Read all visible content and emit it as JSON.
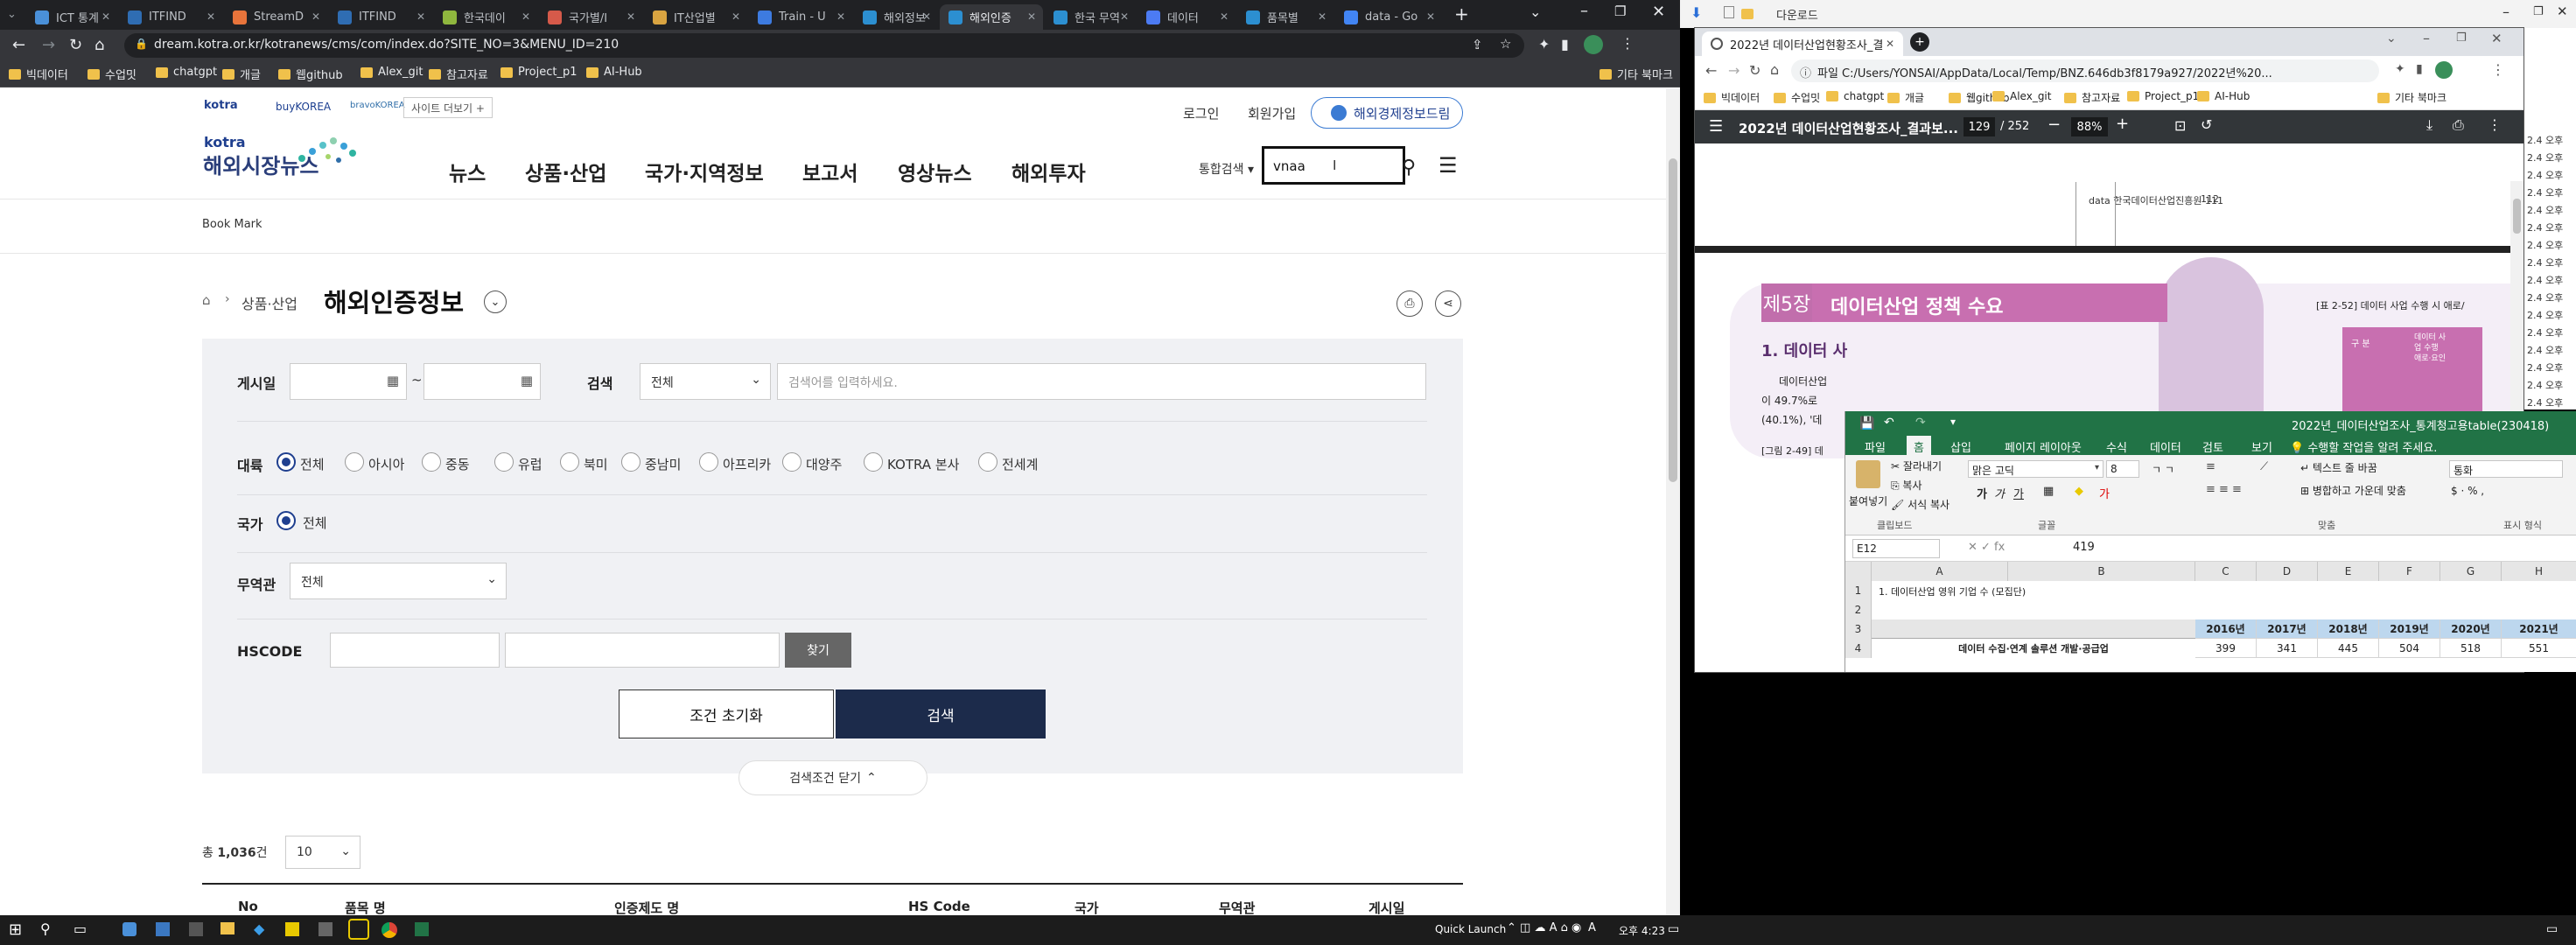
{
  "browser": {
    "tabs": [
      {
        "label": "ICT 통계",
        "color": "#4a90d9"
      },
      {
        "label": "ITFIND",
        "color": "#2f6db3"
      },
      {
        "label": "StreamD",
        "color": "#e8743b"
      },
      {
        "label": "ITFIND",
        "color": "#2f6db3"
      },
      {
        "label": "한국데이",
        "color": "#8fb73e"
      },
      {
        "label": "국가별/I",
        "color": "#d65a4a"
      },
      {
        "label": "IT산업별",
        "color": "#d9a441"
      },
      {
        "label": "Train - U",
        "color": "#3d7be0"
      },
      {
        "label": "해외정보",
        "color": "#2c8fd1"
      },
      {
        "label": "해외인증",
        "color": "#2c8fd1"
      },
      {
        "label": "한국 무역",
        "color": "#2c8fd1"
      },
      {
        "label": "데이터",
        "color": "#4c7bf3"
      },
      {
        "label": "품목별",
        "color": "#2c8fd1"
      },
      {
        "label": "data - Go",
        "color": "#4285f4"
      }
    ],
    "url": "dream.kotra.or.kr/kotranews/cms/com/index.do?SITE_NO=3&MENU_ID=210",
    "bookmarks": [
      "빅데이터",
      "수업밋",
      "chatgpt",
      "개글",
      "웹github",
      "Alex_git",
      "참고자료",
      "Project_p1",
      "AI-Hub"
    ],
    "bookmarks_right": "기타 북마크"
  },
  "kotra": {
    "logos": [
      "kotra",
      "buyKOREA",
      "bravoKOREA"
    ],
    "site_more": "사이트 더보기 +",
    "logo_kotra": "kotra",
    "logo_main": "해외시장뉴스",
    "top_links": [
      "로그인",
      "회원가입"
    ],
    "econ_board": "해외경제정보드림",
    "nav": [
      "뉴스",
      "상품·산업",
      "국가·지역정보",
      "보고서",
      "영상뉴스",
      "해외투자"
    ],
    "search_scope": "통합검색",
    "search_value": "vnaa",
    "bookmark": "Book Mark",
    "breadcrumb": "상품·산업",
    "page_title": "해외인증정보",
    "form": {
      "post_date": "게시일",
      "tilde": "~",
      "search": "검색",
      "search_select": "전체",
      "search_placeholder": "검색어를 입력하세요.",
      "continent": "대륙",
      "continents": [
        "전체",
        "아시아",
        "중동",
        "유럽",
        "북미",
        "중남미",
        "아프리카",
        "대양주",
        "KOTRA 본사",
        "전세계"
      ],
      "country": "국가",
      "country_opt": "전체",
      "trade_office": "무역관",
      "trade_select": "전체",
      "hscode": "HSCODE",
      "find": "찾기",
      "reset": "조건 초기화",
      "submit": "검색",
      "collapse": "검색조건 닫기"
    },
    "total_prefix": "총",
    "total_count": "1,036",
    "total_suffix": "건",
    "page_size": "10",
    "table_headers": [
      "No",
      "품목 명",
      "인증제도 명",
      "HS Code",
      "국가",
      "무역관",
      "게시일"
    ]
  },
  "pdf": {
    "tab_title": "2022년 데이터산업현황조사_결",
    "path": "파일  C:/Users/YONSAI/AppData/Local/Temp/BNZ.646db3f8179a927/2022년%20...",
    "doc_title": "2022년 데이터산업현황조사_결과보...",
    "page_current": "129",
    "page_total": "/ 252",
    "zoom": "88%",
    "footer_left": "data 한국데이터산업진흥원 111",
    "footer_right": "112",
    "chapter_num": "제5장",
    "chapter_title": "데이터산업 정책 수요",
    "table_caption": "[표 2-52] 데이터 사업 수행 시 애로/",
    "section": "1. 데이터 사",
    "body_lines": [
      "데이터산업",
      "이 49.7%로",
      "(40.1%), '데"
    ],
    "figure_caption": "[그림 2-49] 데",
    "side_badges": [
      "구 분",
      "데이터 사",
      "업 수행",
      "애로·요인"
    ],
    "right_dates": [
      "2.4 오후",
      "2.4 오후",
      "2.4 오후",
      "2.4 오후",
      "2.4 오후",
      "2.4 오후",
      "2.4 오후",
      "2.4 오후",
      "2.4 오후",
      "2.4 오후",
      "2.4 오후",
      "2.4 오후",
      "2.4 오후",
      "2.4 오후",
      "2.4 오후",
      "2.4 오후",
      "2.4 오후",
      "2.4 오후"
    ]
  },
  "download_bar": "다운로드",
  "excel": {
    "title": "2022년_데이터산업조사_통계청고용table(230418)",
    "ribbon_tabs": [
      "파일",
      "홈",
      "삽입",
      "페이지 레이아웃",
      "수식",
      "데이터",
      "검토",
      "보기"
    ],
    "tell_me": "수행할 작업을 알려 주세요.",
    "clipboard": [
      "잘라내기",
      "복사",
      "서식 복사"
    ],
    "paste": "붙여넣기",
    "font_name": "맑은 고딕",
    "font_size": "8",
    "wrap": "텍스트 줄 바꿈",
    "merge": "병합하고 가운데 맞춤",
    "number_format": "통화",
    "groups": [
      "클립보드",
      "글꼴",
      "맞춤",
      "표시 형식"
    ],
    "name_box": "E12",
    "formula": "419",
    "columns": [
      "A",
      "B",
      "C",
      "D",
      "E",
      "F",
      "G",
      "H"
    ],
    "row_numbers": [
      "1",
      "2",
      "3",
      "4"
    ],
    "row1": "1. 데이터산업 영위 기업 수 (모집단)",
    "years": [
      "2016년",
      "2017년",
      "2018년",
      "2019년",
      "2020년",
      "2021년"
    ],
    "row4_label": "데이터 수집·연계 솔루션 개발·공급업",
    "row4_values": [
      "399",
      "341",
      "445",
      "504",
      "518",
      "551"
    ]
  },
  "taskbar": {
    "quick_launch": "Quick Launch",
    "time": "오후 4:23",
    "lang": "A"
  }
}
